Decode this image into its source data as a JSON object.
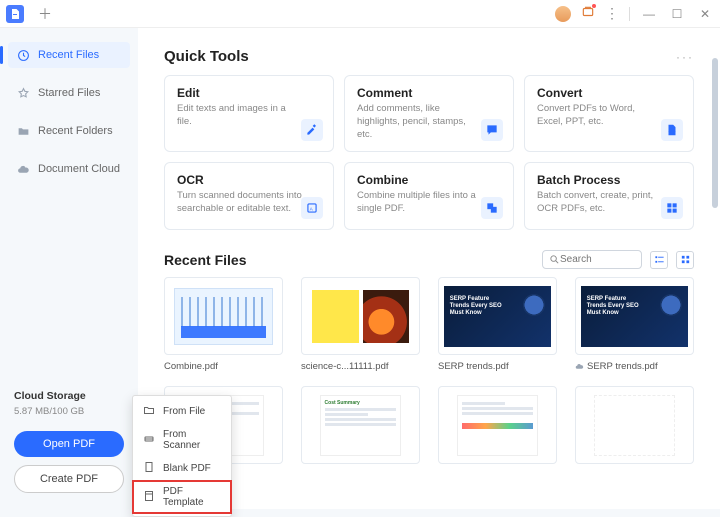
{
  "sidebar": {
    "items": [
      {
        "label": "Recent Files"
      },
      {
        "label": "Starred Files"
      },
      {
        "label": "Recent Folders"
      },
      {
        "label": "Document Cloud"
      }
    ],
    "cloud": {
      "title": "Cloud Storage",
      "usage": "5.87 MB/100 GB"
    },
    "open_btn": "Open PDF",
    "create_btn": "Create PDF"
  },
  "quicktools": {
    "title": "Quick Tools",
    "cards": [
      {
        "title": "Edit",
        "desc": "Edit texts and images in a file."
      },
      {
        "title": "Comment",
        "desc": "Add comments, like highlights, pencil, stamps, etc."
      },
      {
        "title": "Convert",
        "desc": "Convert PDFs to Word, Excel, PPT, etc."
      },
      {
        "title": "OCR",
        "desc": "Turn scanned documents into searchable or editable text."
      },
      {
        "title": "Combine",
        "desc": "Combine multiple files into a single PDF."
      },
      {
        "title": "Batch Process",
        "desc": "Batch convert, create, print, OCR PDFs, etc."
      }
    ]
  },
  "recentfiles": {
    "title": "Recent Files",
    "search_placeholder": "Search",
    "items": [
      {
        "name": "Combine.pdf"
      },
      {
        "name": "science-c...11111.pdf"
      },
      {
        "name": "SERP trends.pdf"
      },
      {
        "name": "SERP trends.pdf",
        "cloud": true
      },
      {
        "name": ""
      },
      {
        "name": ""
      },
      {
        "name": ""
      },
      {
        "name": ""
      }
    ]
  },
  "ctx": {
    "items": [
      "From File",
      "From Scanner",
      "Blank PDF",
      "PDF Template"
    ]
  },
  "serp_thumb": "SERP Feature Trends Every SEO Must Know"
}
